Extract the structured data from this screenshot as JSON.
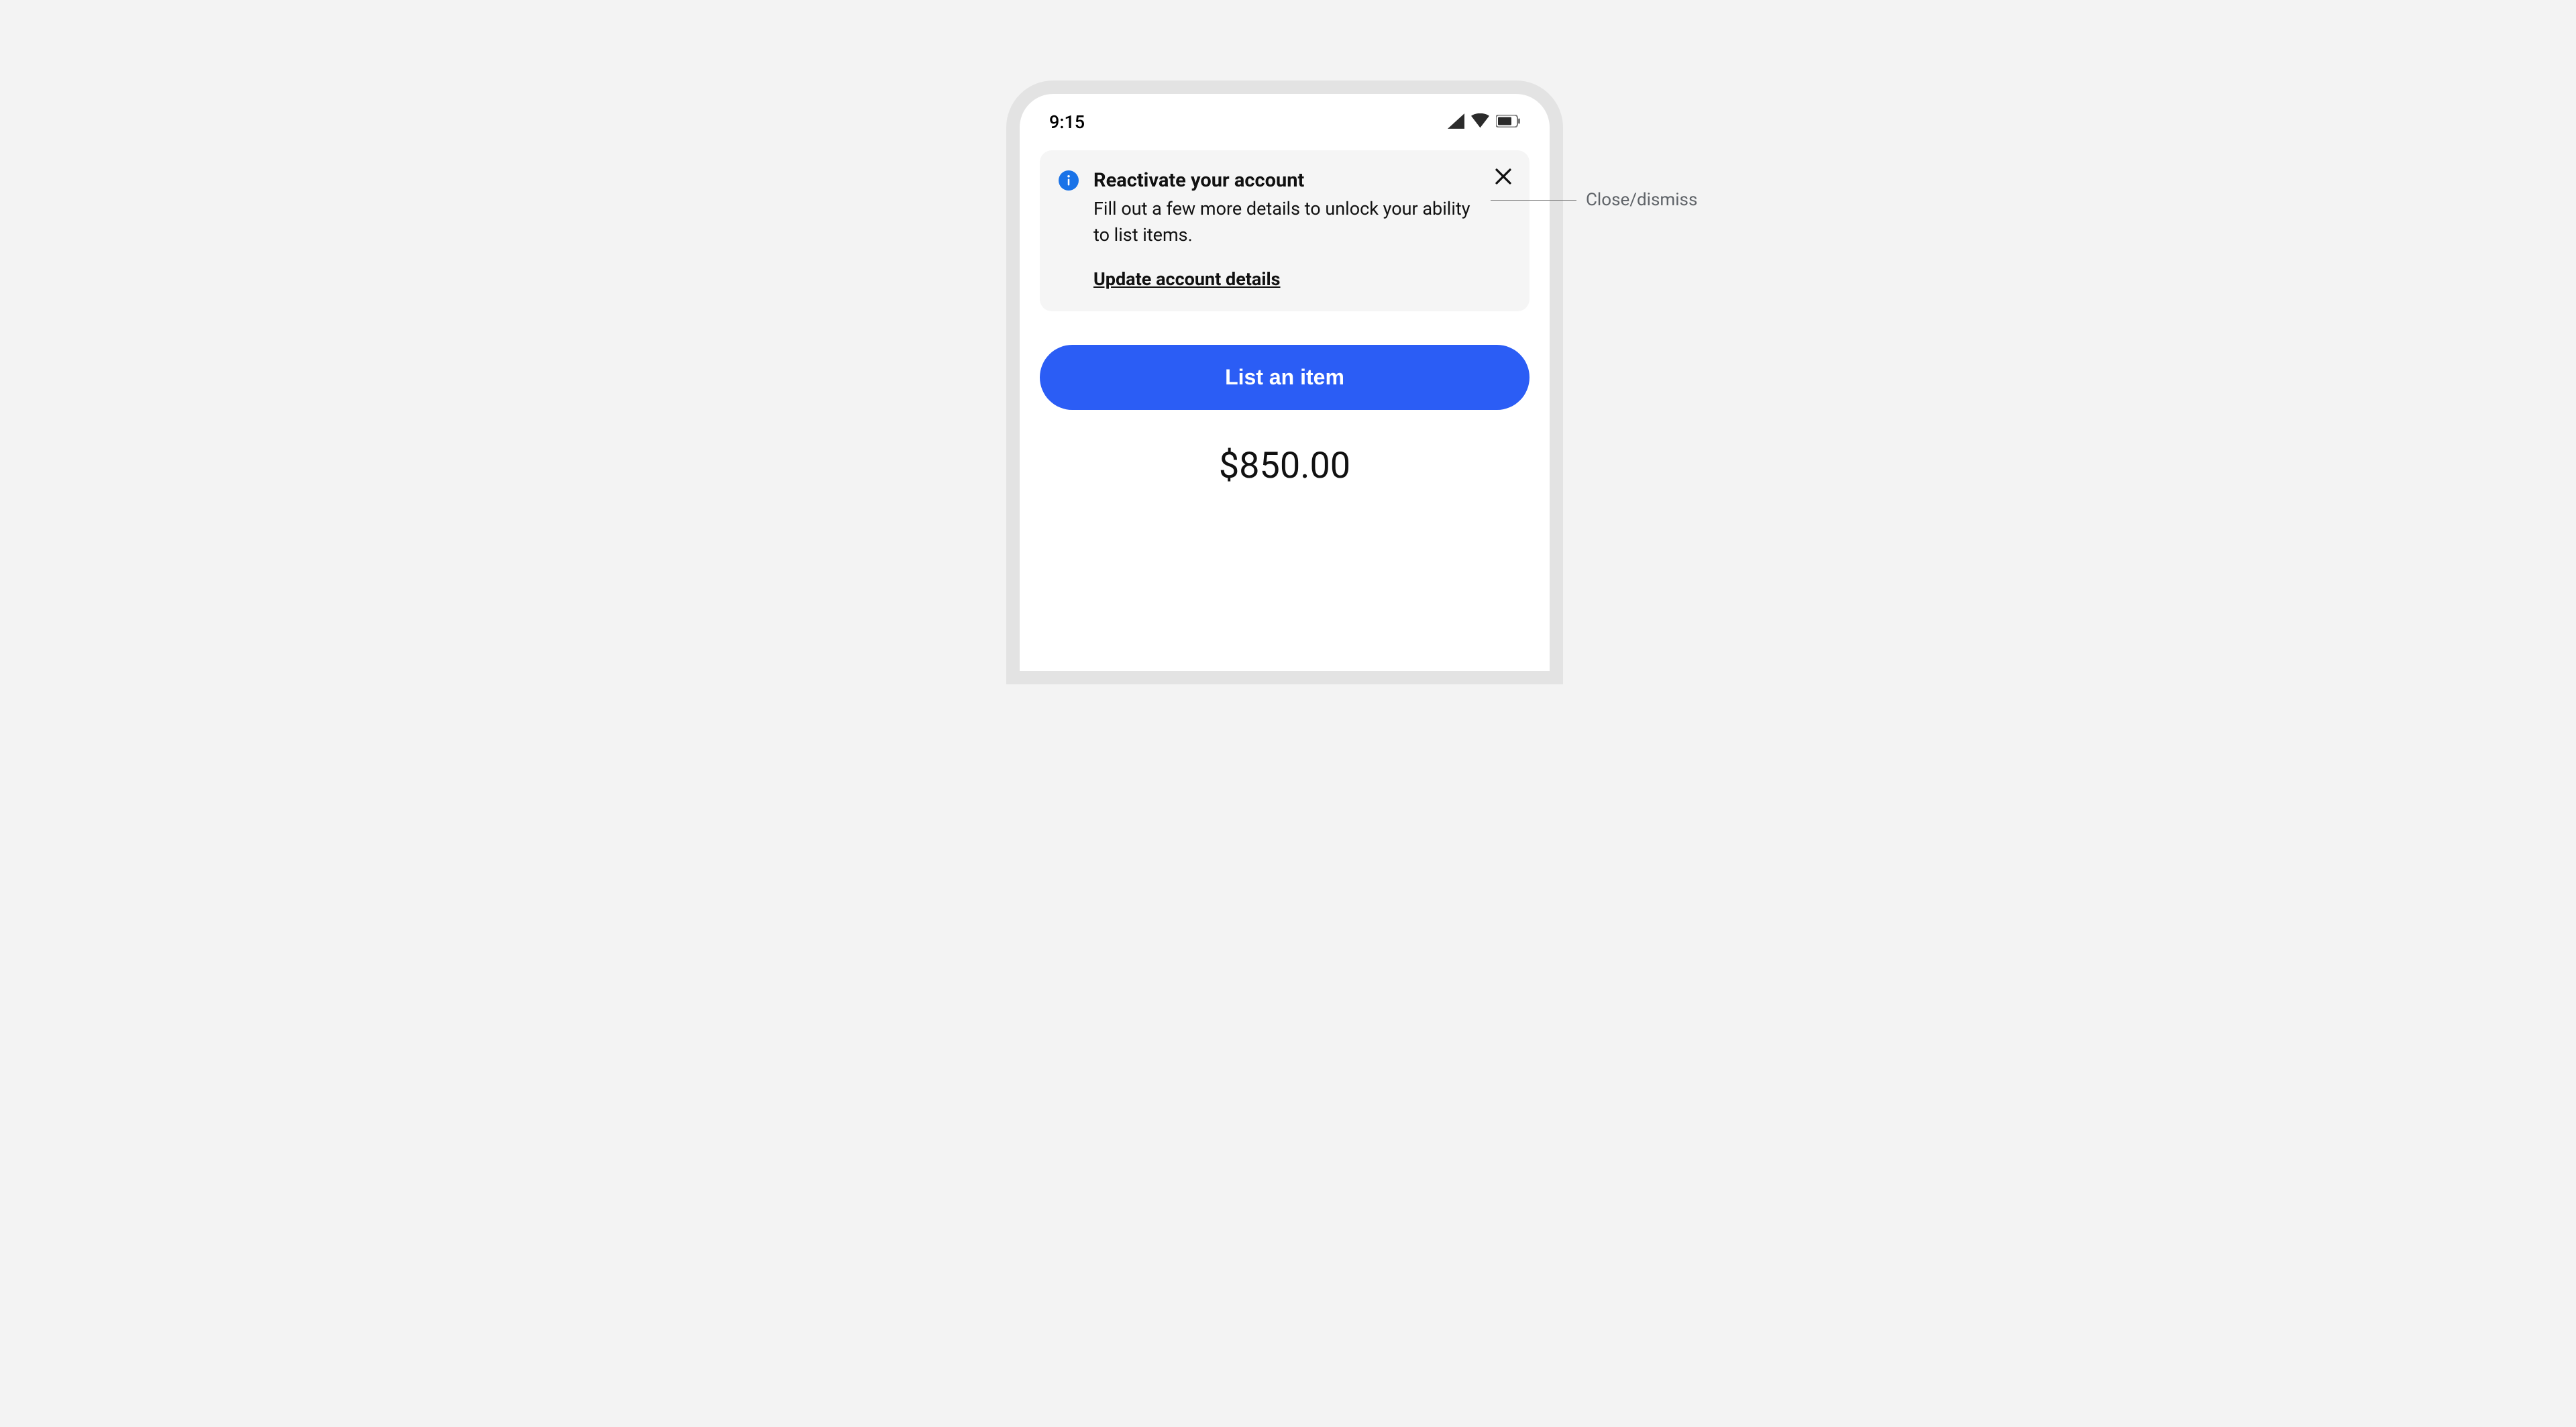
{
  "status_bar": {
    "time": "9:15",
    "icons": {
      "cellular": "cellular-icon",
      "wifi": "wifi-icon",
      "battery": "battery-icon"
    }
  },
  "notice": {
    "icon": "info-icon",
    "title": "Reactivate your account",
    "description": "Fill out a few more details to unlock your ability to list items.",
    "link_label": "Update account details",
    "close_icon": "close-icon"
  },
  "primary_button": {
    "label": "List an item"
  },
  "amount": "$850.00",
  "annotations": {
    "close_dismiss": "Close/dismiss"
  },
  "colors": {
    "accent_blue": "#2b5df5",
    "info_blue": "#1a73e8",
    "notice_bg": "#f5f5f5",
    "frame_border": "#e3e3e3",
    "page_bg": "#f3f3f3"
  }
}
